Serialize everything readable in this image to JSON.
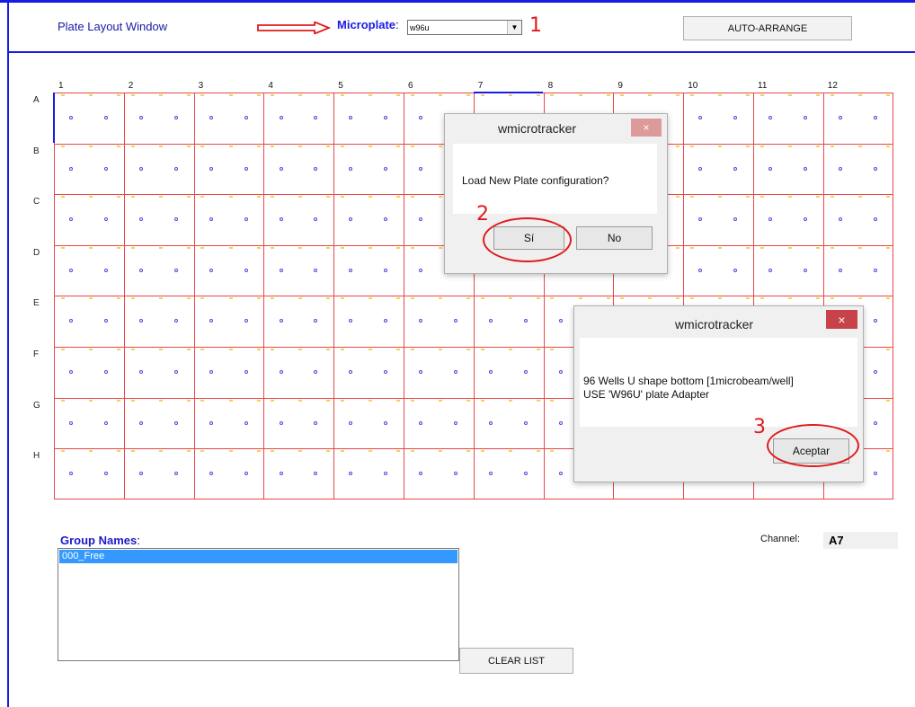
{
  "window": {
    "title": "Plate Layout Window"
  },
  "toolbar": {
    "microplate_label": "Microplate",
    "microplate_colon": ":",
    "microplate_value": "w96u",
    "auto_arrange_label": "AUTO-ARRANGE"
  },
  "annotations": {
    "step1": "1",
    "step2": "2",
    "step3": "3",
    "accent_color": "#e01b1b"
  },
  "plate": {
    "columns": [
      "1",
      "2",
      "3",
      "4",
      "5",
      "6",
      "7",
      "8",
      "9",
      "10",
      "11",
      "12"
    ],
    "rows": [
      "A",
      "B",
      "C",
      "D",
      "E",
      "F",
      "G",
      "H"
    ],
    "grid_color": "#e84848",
    "well_color": "#4a4ae0"
  },
  "dialog_load": {
    "title": "wmicrotracker",
    "close_glyph": "×",
    "message": "Load New Plate configuration?",
    "yes_label": "Sí",
    "no_label": "No"
  },
  "dialog_info": {
    "title": "wmicrotracker",
    "close_glyph": "×",
    "line1": "96 Wells U shape bottom [1microbeam/well]",
    "line2": "USE 'W96U' plate Adapter",
    "ok_label": "Aceptar"
  },
  "groups": {
    "label": "Group Names",
    "colon": ":",
    "items": [
      "000_Free"
    ],
    "clear_label": "CLEAR LIST"
  },
  "channel": {
    "label": "Channel:",
    "value": "A7"
  }
}
